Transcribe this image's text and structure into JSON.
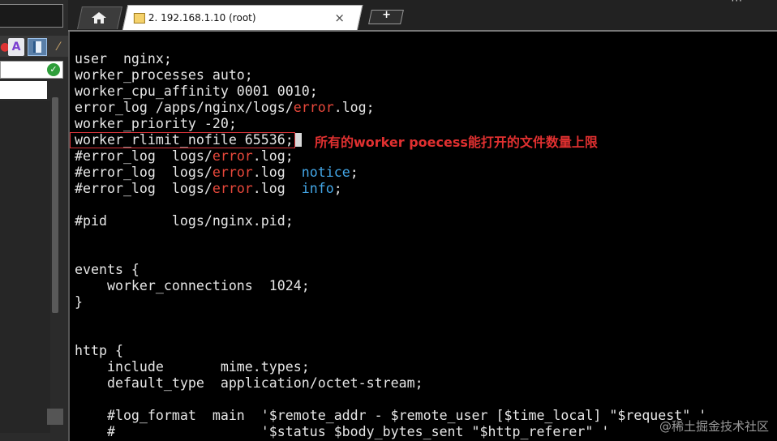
{
  "colors": {
    "terminal_bg": "#000000",
    "terminal_text": "#e6e6e6",
    "highlight_red": "#e8483b",
    "keyword_blue": "#43a6e6",
    "annotation_red": "#e03030"
  },
  "left_panel": {
    "toolbar_icons": [
      "red-icon",
      "font-a-icon",
      "document-icon",
      "magic-wand-icon"
    ],
    "font_button_label": "A",
    "check_icon": "✓"
  },
  "tabs": {
    "home_icon": "home-icon",
    "session_label": "2. 192.168.1.10 (root)",
    "close_label": "×",
    "new_tab_label": "+",
    "dots": "···"
  },
  "terminal": {
    "lines": [
      "user  nginx;",
      "worker_processes auto;",
      "worker_cpu_affinity 0001 0010;",
      "error_log /apps/nginx/logs/error.log;",
      "worker_priority -20;",
      "worker_rlimit_nofile 65536;",
      "#error_log  logs/error.log;",
      "#error_log  logs/error.log  notice;",
      "#error_log  logs/error.log  info;",
      "",
      "#pid        logs/nginx.pid;",
      "",
      "",
      "events {",
      "    worker_connections  1024;",
      "}",
      "",
      "",
      "http {",
      "    include       mime.types;",
      "    default_type  application/octet-stream;",
      "",
      "    #log_format  main  '$remote_addr - $remote_user [$time_local] \"$request\" '",
      "    #                  '$status $body_bytes_sent \"$http_referer\" '"
    ],
    "annotation": "所有的worker poecess能打开的文件数量上限",
    "watermark": "@稀土掘金技术社区"
  }
}
